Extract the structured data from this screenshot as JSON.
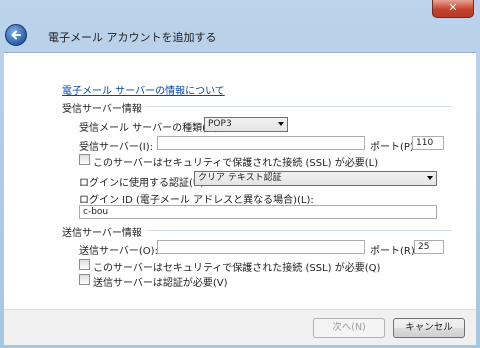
{
  "window": {
    "close_glyph": "✕"
  },
  "header": {
    "title": "電子メール アカウントを追加する"
  },
  "help_link": "電子メール サーバーの情報について",
  "incoming": {
    "section_label": "受信サーバー情報",
    "type_label": "受信メール サーバーの種類(M)",
    "type_value": "POP3",
    "server_label": "受信サーバー(I):",
    "server_value": "",
    "port_label": "ポート(P):",
    "port_value": "110",
    "ssl_label": "このサーバーはセキュリティで保護された接続 (SSL) が必要(L)",
    "auth_label": "ログインに使用する認証(U):",
    "auth_value": "クリア テキスト認証",
    "login_label": "ログイン ID (電子メール アドレスと異なる場合)(L):",
    "login_value": "c-bou"
  },
  "outgoing": {
    "section_label": "送信サーバー情報",
    "server_label": "送信サーバー(O):",
    "server_value": "",
    "port_label": "ポート(R):",
    "port_value": "25",
    "ssl_label": "このサーバーはセキュリティで保護された接続 (SSL) が必要(Q)",
    "auth_required_label": "送信サーバーは認証が必要(V)"
  },
  "footer": {
    "next_label": "次へ(N)",
    "cancel_label": "キャンセル"
  }
}
